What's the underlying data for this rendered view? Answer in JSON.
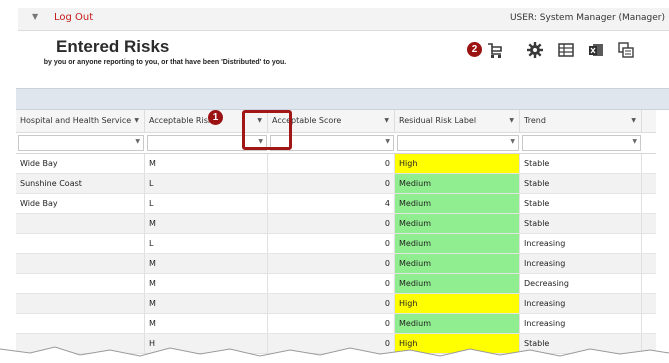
{
  "topbar": {
    "logout_label": "Log Out",
    "user_label": "USER: System Manager (Manager)"
  },
  "header": {
    "title": "Entered Risks",
    "subtitle": "by you or anyone reporting to you, or that have been 'Distributed' to you."
  },
  "badges": {
    "one": "1",
    "two": "2"
  },
  "toolbar": {
    "icons": [
      "cart-icon",
      "gear-icon",
      "grid-view-icon",
      "excel-export-icon",
      "print-icon"
    ]
  },
  "table": {
    "columns": [
      {
        "label": "Hospital and Health Service"
      },
      {
        "label": "Acceptable Risk"
      },
      {
        "label": "Acceptable Score"
      },
      {
        "label": "Residual Risk Label"
      },
      {
        "label": "Trend"
      }
    ],
    "rows": [
      {
        "hhs": "Wide Bay",
        "acc_risk": "M",
        "acc_score": "0",
        "residual": "High",
        "trend": "Stable"
      },
      {
        "hhs": "Sunshine Coast",
        "acc_risk": "L",
        "acc_score": "0",
        "residual": "Medium",
        "trend": "Stable"
      },
      {
        "hhs": "Wide Bay",
        "acc_risk": "L",
        "acc_score": "4",
        "residual": "Medium",
        "trend": "Stable"
      },
      {
        "hhs": "",
        "acc_risk": "M",
        "acc_score": "0",
        "residual": "Medium",
        "trend": "Stable"
      },
      {
        "hhs": "",
        "acc_risk": "L",
        "acc_score": "0",
        "residual": "Medium",
        "trend": "Increasing"
      },
      {
        "hhs": "",
        "acc_risk": "M",
        "acc_score": "0",
        "residual": "Medium",
        "trend": "Increasing"
      },
      {
        "hhs": "",
        "acc_risk": "M",
        "acc_score": "0",
        "residual": "Medium",
        "trend": "Decreasing"
      },
      {
        "hhs": "",
        "acc_risk": "M",
        "acc_score": "0",
        "residual": "High",
        "trend": "Increasing"
      },
      {
        "hhs": "",
        "acc_risk": "M",
        "acc_score": "0",
        "residual": "Medium",
        "trend": "Increasing"
      },
      {
        "hhs": "",
        "acc_risk": "H",
        "acc_score": "0",
        "residual": "High",
        "trend": "Stable"
      }
    ]
  },
  "colors": {
    "high": "#ffff00",
    "medium": "#90ee90",
    "badge": "#9b1212",
    "logout": "#c21a1a"
  }
}
